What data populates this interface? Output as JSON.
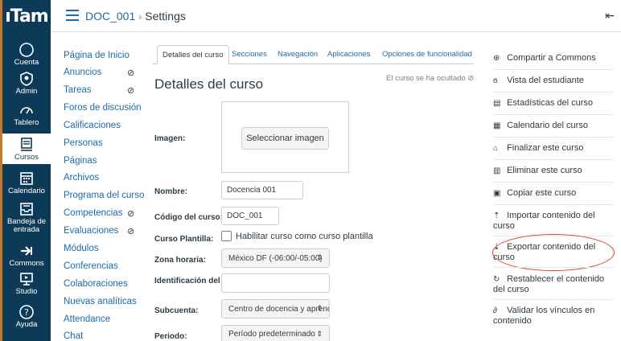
{
  "brand": {
    "logo_text": "ıTam"
  },
  "global_nav": [
    {
      "label": "Cuenta",
      "icon": "account-icon"
    },
    {
      "label": "Admin",
      "icon": "admin-shield-icon"
    },
    {
      "label": "Tablero",
      "icon": "dashboard-icon"
    },
    {
      "label": "Cursos",
      "icon": "courses-icon",
      "active": true
    },
    {
      "label": "Calendario",
      "icon": "calendar-icon"
    },
    {
      "label": "Bandeja de entrada",
      "icon": "inbox-icon"
    },
    {
      "label": "Commons",
      "icon": "commons-icon"
    },
    {
      "label": "Studio",
      "icon": "studio-icon"
    },
    {
      "label": "Ayuda",
      "icon": "help-icon"
    }
  ],
  "header": {
    "course": "DOC_001",
    "separator": "›",
    "page": "Settings",
    "collapse_glyph": "⇤"
  },
  "course_nav": [
    {
      "label": "Página de Inicio"
    },
    {
      "label": "Anuncios",
      "hidden": true
    },
    {
      "label": "Tareas",
      "hidden": true
    },
    {
      "label": "Foros de discusión"
    },
    {
      "label": "Calificaciones"
    },
    {
      "label": "Personas"
    },
    {
      "label": "Páginas"
    },
    {
      "label": "Archivos"
    },
    {
      "label": "Programa del curso"
    },
    {
      "label": "Competencias",
      "hidden": true
    },
    {
      "label": "Evaluaciones",
      "hidden": true
    },
    {
      "label": "Módulos"
    },
    {
      "label": "Conferencias"
    },
    {
      "label": "Colaboraciones"
    },
    {
      "label": "Nuevas analíticas"
    },
    {
      "label": "Attendance"
    },
    {
      "label": "Chat"
    }
  ],
  "tabs": [
    {
      "label": "Detalles del curso",
      "active": true
    },
    {
      "label": "Secciones"
    },
    {
      "label": "Navegación"
    },
    {
      "label": "Aplicaciones"
    },
    {
      "label": "Opciones de funcionalidad"
    }
  ],
  "main": {
    "title": "Detalles del curso",
    "hidden_note": "El curso se ha ocultado",
    "fields": {
      "image_label": "Imagen:",
      "image_button": "Seleccionar imagen",
      "name_label": "Nombre:",
      "name_value": "Docencia 001",
      "code_label": "Código del curso:",
      "code_value": "DOC_001",
      "template_label": "Curso Plantilla:",
      "template_checkbox": "Habilitar curso como curso plantilla",
      "timezone_label": "Zona horaria:",
      "timezone_value": "México DF (-06:00/-05:00)",
      "sis_label": "Identificación del SIS:",
      "sis_value": "",
      "subaccount_label": "Subcuenta:",
      "subaccount_value": "Centro de docencia y aprendiz",
      "term_label": "Periodo:",
      "term_value": "Período predeterminado"
    }
  },
  "sidebar_actions": [
    {
      "label": "Compartir a Commons",
      "icon": "share-icon"
    },
    {
      "label": "Vista del estudiante",
      "icon": "student-view-icon"
    },
    {
      "label": "Estadísticas del curso",
      "icon": "stats-icon"
    },
    {
      "label": "Calendario del curso",
      "icon": "calendar-icon"
    },
    {
      "label": "Finalizar este curso",
      "icon": "lock-icon"
    },
    {
      "label": "Eliminar este curso",
      "icon": "trash-icon"
    },
    {
      "label": "Copiar este curso",
      "icon": "copy-icon"
    },
    {
      "label": "Importar contenido del curso",
      "icon": "import-icon"
    },
    {
      "label": "Exportar contenido del curso",
      "icon": "export-icon",
      "highlighted": true
    },
    {
      "label": "Restablecer el contenido del curso",
      "icon": "reset-icon"
    },
    {
      "label": "Validar los vínculos en contenido",
      "icon": "link-icon"
    }
  ],
  "colors": {
    "nav_bg": "#0d3b57",
    "link": "#1e6aa8",
    "highlight_circle": "#e0392a"
  }
}
